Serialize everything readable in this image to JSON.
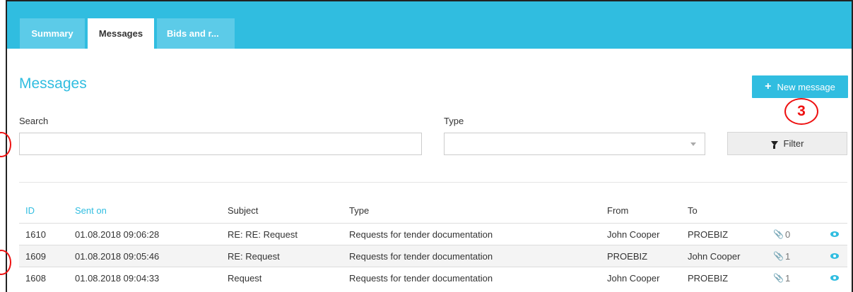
{
  "tabs": [
    {
      "label": "Summary"
    },
    {
      "label": "Messages"
    },
    {
      "label": "Bids and r..."
    }
  ],
  "page": {
    "title": "Messages"
  },
  "toolbar": {
    "new_message_label": "New message",
    "filter_label": "Filter"
  },
  "annotation": {
    "badge": "3"
  },
  "filters": {
    "search_label": "Search",
    "search_value": "",
    "type_label": "Type",
    "type_value": ""
  },
  "table": {
    "headers": {
      "id": "ID",
      "sent_on": "Sent on",
      "subject": "Subject",
      "type": "Type",
      "from": "From",
      "to": "To"
    },
    "rows": [
      {
        "id": "1610",
        "sent_on": "01.08.2018 09:06:28",
        "subject": "RE: RE: Request",
        "type": "Requests for tender documentation",
        "from": "John Cooper",
        "to": "PROEBIZ",
        "attachments": "0"
      },
      {
        "id": "1609",
        "sent_on": "01.08.2018 09:05:46",
        "subject": "RE: Request",
        "type": "Requests for tender documentation",
        "from": "PROEBIZ",
        "to": "John Cooper",
        "attachments": "1"
      },
      {
        "id": "1608",
        "sent_on": "01.08.2018 09:04:33",
        "subject": "Request",
        "type": "Requests for tender documentation",
        "from": "John Cooper",
        "to": "PROEBIZ",
        "attachments": "1"
      }
    ]
  },
  "icons": {
    "add": "plus-icon",
    "filter": "funnel-icon",
    "attachment": "paperclip-icon",
    "view": "eye-icon",
    "dropdown": "caret-down-icon"
  },
  "colors": {
    "accent": "#30bde0",
    "annotation": "#ee1111"
  }
}
